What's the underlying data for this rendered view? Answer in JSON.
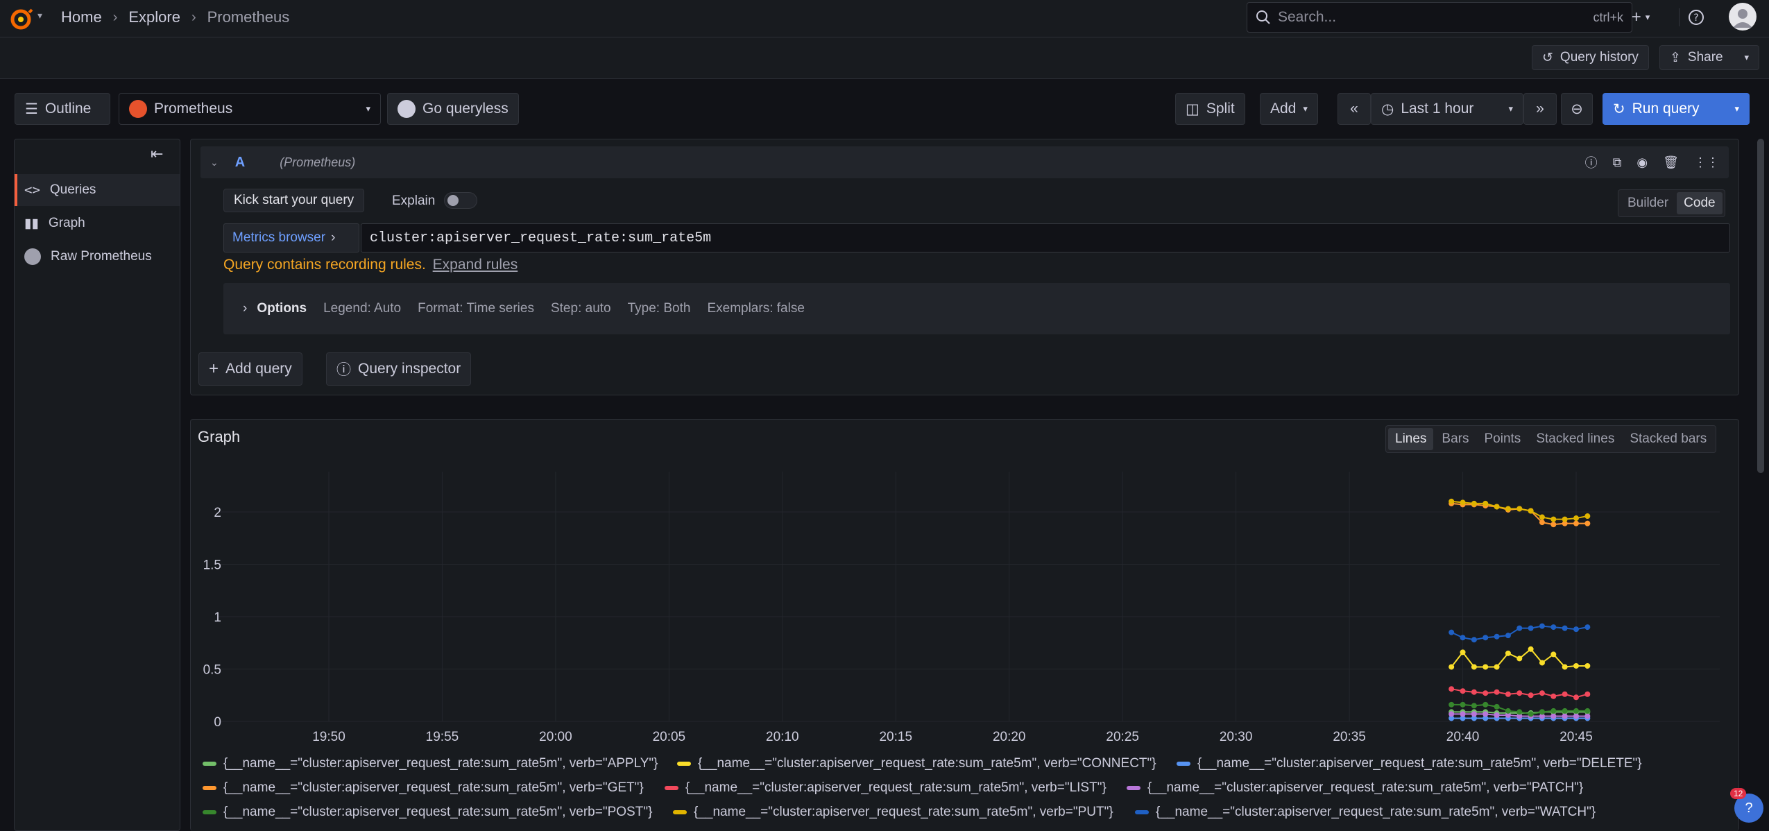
{
  "topbar": {
    "crumbs": [
      "Home",
      "Explore",
      "Prometheus"
    ],
    "search_placeholder": "Search...",
    "search_kbd": "ctrl+k"
  },
  "subbar": {
    "query_history": "Query history",
    "share": "Share"
  },
  "toolbar": {
    "outline": "Outline",
    "datasource": "Prometheus",
    "go_queryless": "Go queryless",
    "split": "Split",
    "add": "Add",
    "time_range": "Last 1 hour",
    "run_query": "Run query"
  },
  "sidebar": {
    "items": [
      {
        "label": "Queries",
        "icon": "code-icon"
      },
      {
        "label": "Graph",
        "icon": "bar-chart-icon"
      },
      {
        "label": "Raw Prometheus",
        "icon": "prometheus-icon"
      }
    ]
  },
  "query": {
    "ref": "A",
    "ds": "(Prometheus)",
    "kick_start": "Kick start your query",
    "explain": "Explain",
    "builder": "Builder",
    "code": "Code",
    "metrics_browser": "Metrics browser",
    "expr": "cluster:apiserver_request_rate:sum_rate5m",
    "warning": "Query contains recording rules.",
    "expand_rules": "Expand rules",
    "options_label": "Options",
    "options": [
      "Legend: Auto",
      "Format: Time series",
      "Step: auto",
      "Type: Both",
      "Exemplars: false"
    ],
    "add_query": "Add query",
    "query_inspector": "Query inspector"
  },
  "graph": {
    "title": "Graph",
    "modes": [
      "Lines",
      "Bars",
      "Points",
      "Stacked lines",
      "Stacked bars"
    ],
    "active_mode": "Lines"
  },
  "notification_count": "12",
  "chart_data": {
    "type": "line",
    "x_ticks": [
      "19:50",
      "19:55",
      "20:00",
      "20:05",
      "20:10",
      "20:15",
      "20:20",
      "20:25",
      "20:30",
      "20:35",
      "20:40",
      "20:45"
    ],
    "y_ticks": [
      "0",
      "0.5",
      "1",
      "1.5",
      "2"
    ],
    "ylim": [
      0,
      2.3
    ],
    "x": [
      "20:39:30",
      "20:40",
      "20:40:30",
      "20:41",
      "20:41:30",
      "20:42",
      "20:42:30",
      "20:43",
      "20:43:30",
      "20:44",
      "20:44:30",
      "20:45",
      "20:45:30"
    ],
    "series": [
      {
        "name": "{__name__=\"cluster:apiserver_request_rate:sum_rate5m\", verb=\"APPLY\"}",
        "color": "#73bf69",
        "values": [
          0.09,
          0.09,
          0.09,
          0.09,
          0.08,
          0.08,
          0.08,
          0.08,
          0.09,
          0.09,
          0.09,
          0.09,
          0.09
        ]
      },
      {
        "name": "{__name__=\"cluster:apiserver_request_rate:sum_rate5m\", verb=\"CONNECT\"}",
        "color": "#fade2a",
        "values": [
          0.52,
          0.66,
          0.52,
          0.52,
          0.52,
          0.65,
          0.6,
          0.69,
          0.56,
          0.64,
          0.52,
          0.53,
          0.53
        ]
      },
      {
        "name": "{__name__=\"cluster:apiserver_request_rate:sum_rate5m\", verb=\"DELETE\"}",
        "color": "#5794f2",
        "values": [
          0.03,
          0.03,
          0.03,
          0.03,
          0.03,
          0.03,
          0.03,
          0.03,
          0.03,
          0.03,
          0.03,
          0.03,
          0.03
        ]
      },
      {
        "name": "{__name__=\"cluster:apiserver_request_rate:sum_rate5m\", verb=\"GET\"}",
        "color": "#ff9830",
        "values": [
          2.08,
          2.07,
          2.07,
          2.06,
          2.05,
          2.02,
          2.03,
          2.01,
          1.9,
          1.88,
          1.89,
          1.89,
          1.89
        ]
      },
      {
        "name": "{__name__=\"cluster:apiserver_request_rate:sum_rate5m\", verb=\"LIST\"}",
        "color": "#f2495c",
        "values": [
          0.31,
          0.29,
          0.28,
          0.27,
          0.28,
          0.26,
          0.27,
          0.25,
          0.27,
          0.24,
          0.26,
          0.23,
          0.26
        ]
      },
      {
        "name": "{__name__=\"cluster:apiserver_request_rate:sum_rate5m\", verb=\"PATCH\"}",
        "color": "#b877d9",
        "values": [
          0.07,
          0.07,
          0.07,
          0.07,
          0.06,
          0.06,
          0.05,
          0.05,
          0.05,
          0.05,
          0.05,
          0.05,
          0.05
        ]
      },
      {
        "name": "{__name__=\"cluster:apiserver_request_rate:sum_rate5m\", verb=\"POST\"}",
        "color": "#37872d",
        "values": [
          0.16,
          0.16,
          0.15,
          0.16,
          0.14,
          0.1,
          0.09,
          0.07,
          0.09,
          0.1,
          0.1,
          0.1,
          0.1
        ]
      },
      {
        "name": "{__name__=\"cluster:apiserver_request_rate:sum_rate5m\", verb=\"PUT\"}",
        "color": "#e0b400",
        "values": [
          2.1,
          2.09,
          2.08,
          2.08,
          2.05,
          2.03,
          2.03,
          2.01,
          1.95,
          1.93,
          1.93,
          1.94,
          1.96
        ]
      },
      {
        "name": "{__name__=\"cluster:apiserver_request_rate:sum_rate5m\", verb=\"WATCH\"}",
        "color": "#1f60c4",
        "values": [
          0.85,
          0.8,
          0.78,
          0.8,
          0.81,
          0.82,
          0.89,
          0.89,
          0.91,
          0.9,
          0.89,
          0.88,
          0.9
        ]
      }
    ]
  }
}
